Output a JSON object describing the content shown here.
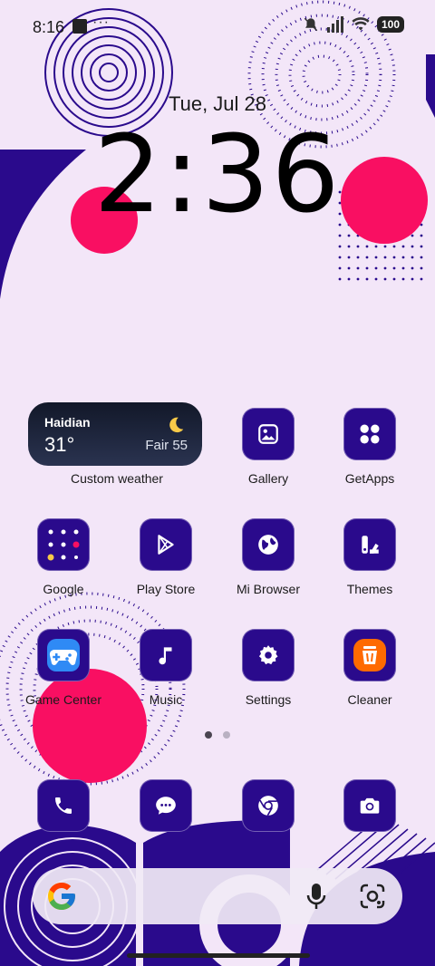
{
  "status_bar": {
    "time": "8:16",
    "battery": "100",
    "icons": [
      "notification-square-icon",
      "more-dots-icon",
      "mute-icon",
      "signal-icon",
      "wifi-icon",
      "battery-icon"
    ]
  },
  "lockscreen": {
    "date": "Tue, Jul 28",
    "clock": "2:36"
  },
  "weather_widget": {
    "city": "Haidian",
    "temperature": "31°",
    "condition": "Fair 55",
    "icon": "moon-icon",
    "label": "Custom weather"
  },
  "apps": [
    {
      "name": "Gallery",
      "icon": "gallery-icon"
    },
    {
      "name": "GetApps",
      "icon": "getapps-icon"
    },
    {
      "name": "Google",
      "icon": "google-folder-icon"
    },
    {
      "name": "Play Store",
      "icon": "play-store-icon"
    },
    {
      "name": "Mi Browser",
      "icon": "globe-icon"
    },
    {
      "name": "Themes",
      "icon": "themes-icon"
    },
    {
      "name": "Game Center",
      "icon": "gamepad-icon"
    },
    {
      "name": "Music",
      "icon": "music-note-icon"
    },
    {
      "name": "Settings",
      "icon": "gear-icon"
    },
    {
      "name": "Cleaner",
      "icon": "trash-icon"
    }
  ],
  "pager": {
    "pages": 2,
    "current": 1
  },
  "dock": [
    {
      "name": "Phone",
      "icon": "phone-icon"
    },
    {
      "name": "Messages",
      "icon": "message-icon"
    },
    {
      "name": "Chrome",
      "icon": "chrome-icon"
    },
    {
      "name": "Camera",
      "icon": "camera-icon"
    }
  ],
  "search_bar": {
    "icons": [
      "google-g-icon",
      "mic-icon",
      "lens-icon"
    ]
  },
  "colors": {
    "accent": "#2a0a8c",
    "pink": "#f90f62",
    "background": "#f3e6f8"
  }
}
